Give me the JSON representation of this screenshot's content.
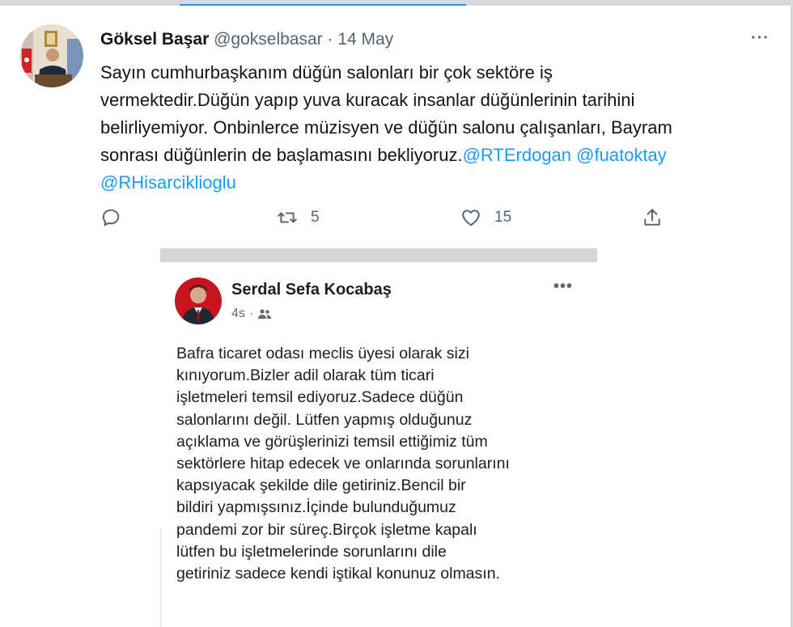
{
  "tweet": {
    "author_name": "Göksel Başar",
    "handle": "@gokselbasar",
    "separator": "·",
    "date": "14 May",
    "more": "···",
    "text_lines": [
      "Sayın cumhurbaşkanım düğün salonları bir çok sektöre iş",
      "vermektedir.Düğün yapıp yuva kuracak insanlar düğünlerinin tarihini",
      "belirliyemiyor. Onbinlerce müzisyen ve düğün salonu çalışanları, Bayram"
    ],
    "line4_text": "sonrası düğünlerin de başlamasını bekliyoruz.",
    "mentions": [
      "@RTErdogan",
      "@fuatoktay",
      "@RHisarciklioglu"
    ],
    "actions": {
      "reply_count": "",
      "retweet_count": "5",
      "like_count": "15"
    },
    "colors": {
      "link": "#1d9bf0",
      "muted": "#536471"
    }
  },
  "embedded_post": {
    "author_name": "Serdal Sefa Kocabaş",
    "time": "4s",
    "separator": "·",
    "audience_icon": "friends-icon",
    "more": "•••",
    "text_lines": [
      "Bafra ticaret odası meclis üyesi olarak sizi",
      "kınıyorum.Bizler adil olarak tüm ticari",
      "işletmeleri temsil ediyoruz.Sadece düğün",
      "salonlarını değil. Lütfen yapmış olduğunuz",
      "açıklama ve görüşlerinizi temsil ettiğimiz tüm",
      "sektörlere hitap edecek ve onlarında sorunlarını",
      "kapsıyacak şekilde dile getiriniz.Bencil bir",
      "bildiri yapmışsınız.İçinde bulunduğumuz",
      "pandemi zor bir süreç.Birçok işletme kapalı",
      "lütfen bu işletmelerinde sorunlarını dile",
      "getiriniz sadece kendi iştikal konunuz olmasın."
    ]
  }
}
